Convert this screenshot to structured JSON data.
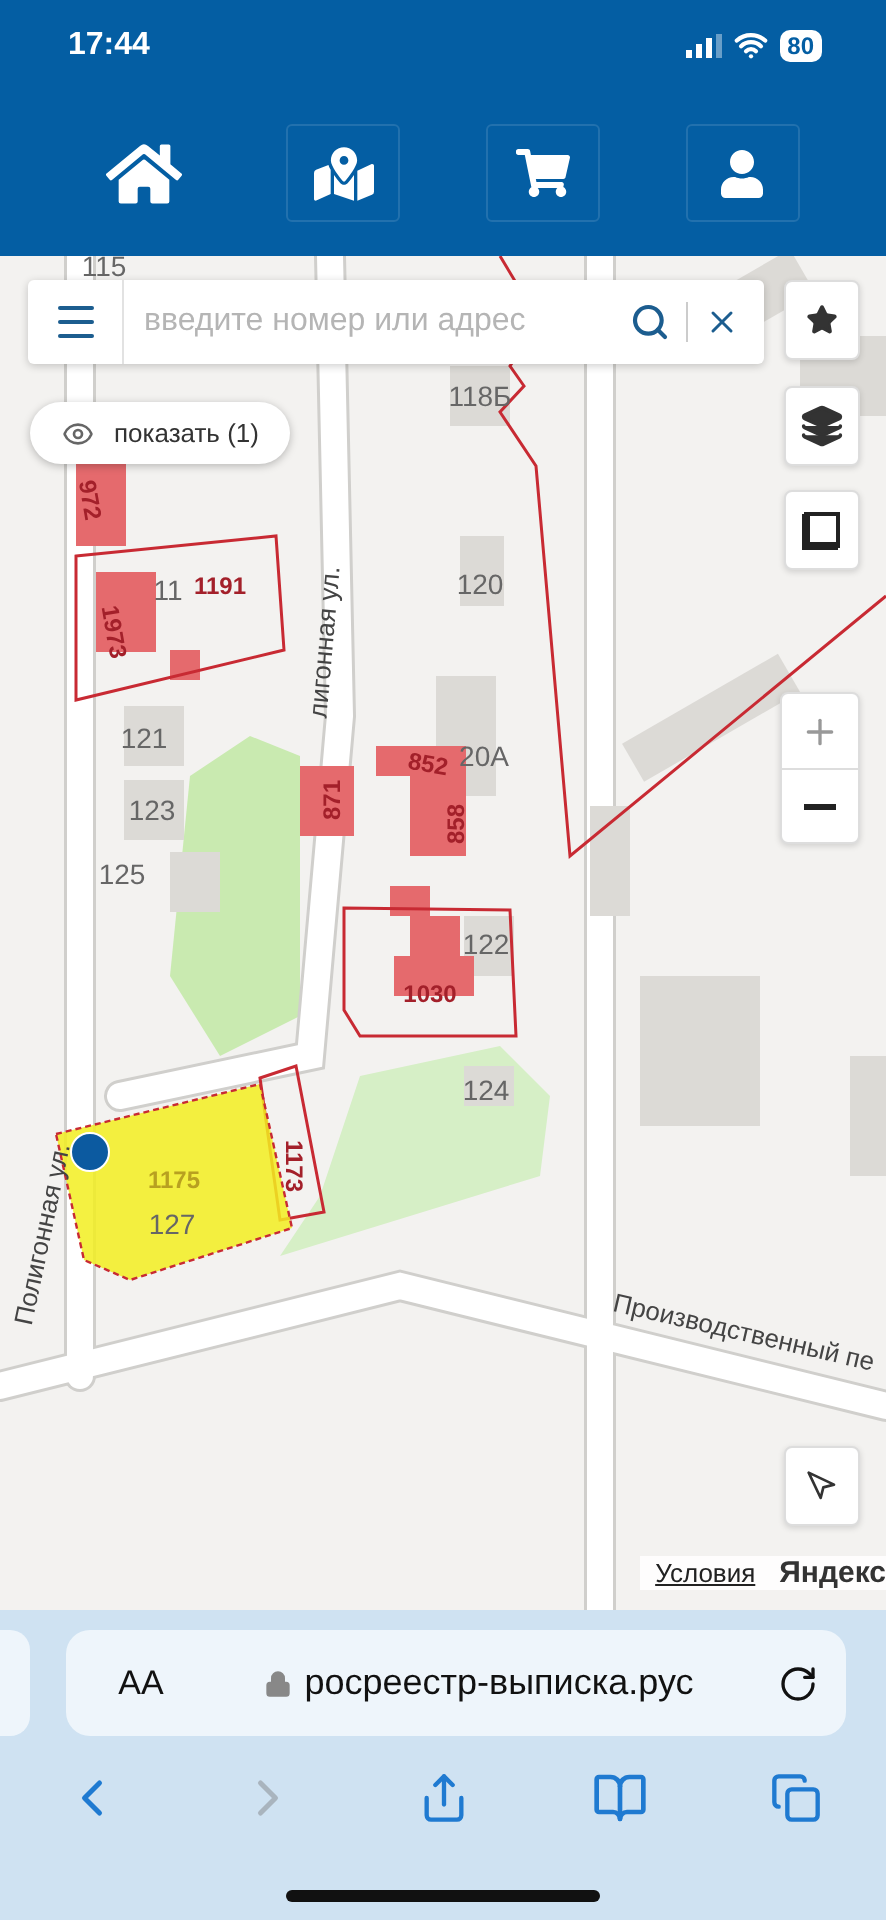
{
  "status_bar": {
    "time": "17:44",
    "battery": "80"
  },
  "nav": [
    {
      "kind": "home"
    },
    {
      "kind": "map"
    },
    {
      "kind": "cart"
    },
    {
      "kind": "user"
    }
  ],
  "search": {
    "placeholder": "введите номер или адрес"
  },
  "show_button": {
    "label": "показать (1)"
  },
  "map_labels": [
    {
      "text": "115",
      "kind": "house"
    },
    {
      "text": "118Б",
      "kind": "house"
    },
    {
      "text": "972",
      "kind": "parcel"
    },
    {
      "text": "11",
      "kind": "house"
    },
    {
      "text": "1191",
      "kind": "parcel"
    },
    {
      "text": "1973",
      "kind": "parcel"
    },
    {
      "text": "120",
      "kind": "house"
    },
    {
      "text": "121",
      "kind": "house"
    },
    {
      "text": "123",
      "kind": "house"
    },
    {
      "text": "125",
      "kind": "house"
    },
    {
      "text": "лигонная ул.",
      "kind": "street"
    },
    {
      "text": "871",
      "kind": "parcel"
    },
    {
      "text": "20А",
      "kind": "house"
    },
    {
      "text": "852",
      "kind": "parcel"
    },
    {
      "text": "858",
      "kind": "parcel"
    },
    {
      "text": "122",
      "kind": "house"
    },
    {
      "text": "1030",
      "kind": "parcel"
    },
    {
      "text": "124",
      "kind": "house"
    },
    {
      "text": "1175",
      "kind": "selected_parcel"
    },
    {
      "text": "127",
      "kind": "house"
    },
    {
      "text": "1173",
      "kind": "parcel"
    },
    {
      "text": "Полигонная ул.",
      "kind": "street"
    },
    {
      "text": "Производственный пе",
      "kind": "street"
    }
  ],
  "map_attribution": {
    "terms": "Условия",
    "logo": "Яндекс"
  },
  "browser": {
    "text_size": "AA",
    "url": "росреестр-выписка.рус",
    "toolbar": [
      {
        "kind": "back",
        "disabled": false
      },
      {
        "kind": "forward",
        "disabled": true
      },
      {
        "kind": "share",
        "disabled": false
      },
      {
        "kind": "bookmarks",
        "disabled": false
      },
      {
        "kind": "tabs",
        "disabled": false
      }
    ]
  }
}
